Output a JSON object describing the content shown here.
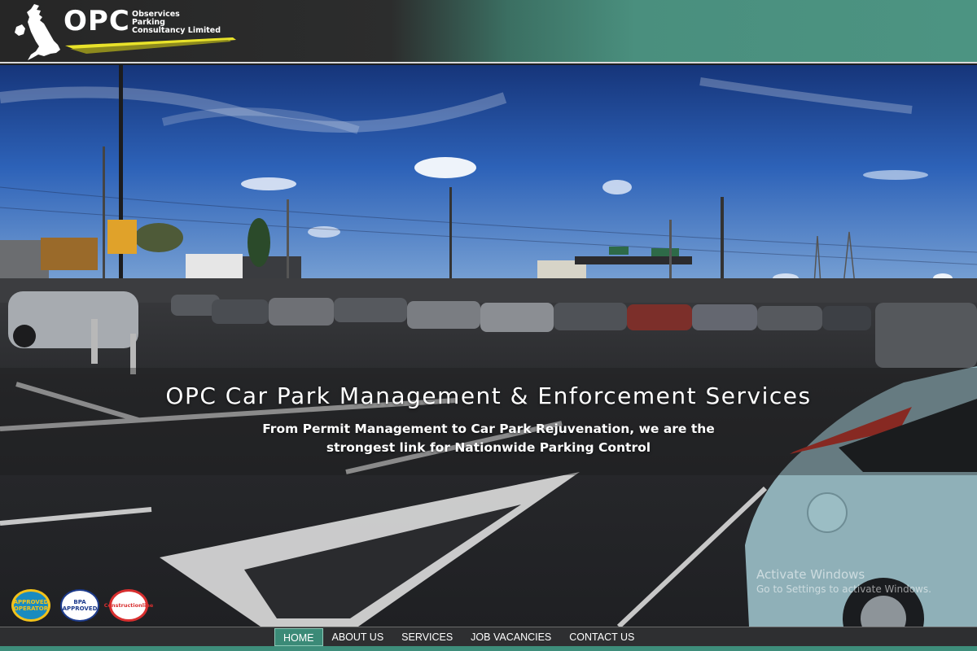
{
  "header": {
    "logo_letters": "OPC",
    "logo_tagline": [
      "Observices",
      "Parking",
      "Consultancy Limited"
    ],
    "map_icon": "uk-map-icon"
  },
  "hero": {
    "title": "OPC Car Park Management & Enforcement Services",
    "subtitle": "From Permit Management to Car Park Rejuvenation, we are the strongest link for Nationwide Parking Control"
  },
  "badges": [
    {
      "name": "approved-operator-badge",
      "text": "APPROVED OPERATOR"
    },
    {
      "name": "bpa-approved-badge",
      "text": "BPA APPROVED"
    },
    {
      "name": "constructionline-badge",
      "text": "Constructionline"
    }
  ],
  "watermark": {
    "line1": "Activate Windows",
    "line2": "Go to Settings to activate Windows."
  },
  "nav": {
    "items": [
      "HOME",
      "ABOUT US",
      "SERVICES",
      "JOB VACANCIES",
      "CONTACT US"
    ],
    "active": "HOME"
  },
  "colors": {
    "header_dark": "#262626",
    "header_teal": "#4c9482",
    "accent_teal": "#3b8a77",
    "logo_yellow": "#e9e32a"
  }
}
